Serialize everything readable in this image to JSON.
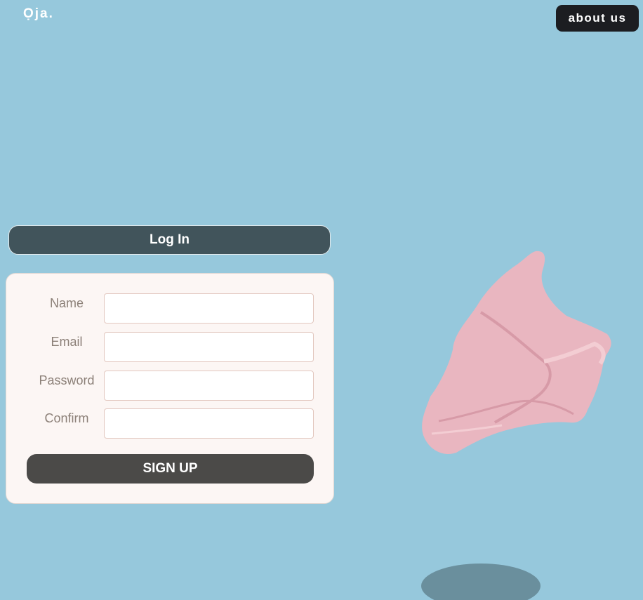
{
  "header": {
    "logo": "Ọja.",
    "about_label": "about us"
  },
  "login": {
    "label": "Log In"
  },
  "signup_form": {
    "fields": [
      {
        "label": "Name",
        "value": "",
        "placeholder": ""
      },
      {
        "label": "Email",
        "value": "",
        "placeholder": ""
      },
      {
        "label": "Password",
        "value": "",
        "placeholder": ""
      },
      {
        "label": "Confirm",
        "value": "",
        "placeholder": ""
      }
    ],
    "submit_label": "SIGN UP"
  },
  "colors": {
    "background": "#96c8dc",
    "login_button": "#41545b",
    "signup_button": "#4b4a48",
    "about_button": "#1c1d21",
    "card": "#fcf6f4",
    "shoe": "#e9b6c0"
  },
  "images": {
    "hero": "pink-sneaker-image"
  }
}
